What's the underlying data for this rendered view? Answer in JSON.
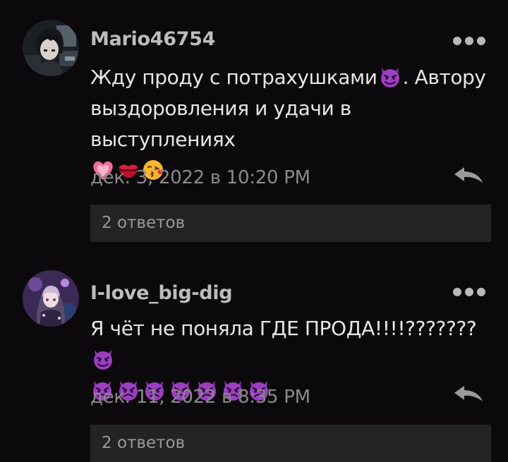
{
  "comments": [
    {
      "username": "Mario46754",
      "text_line1": "Жду проду с потрахушками",
      "text_line1_tail": ". Автору",
      "text_line2": "выздоровления и удачи в выступлениях",
      "timestamp": "дек. 3, 2022 в 10:20 PM",
      "replies_label": "2 ответов",
      "avatar_icon": "avatar-anime-boy",
      "emojis_line1": [
        "smiling-imp-emoji"
      ],
      "emojis_line3": [
        "growing-heart-emoji",
        "kiss-mark-emoji",
        "kissing-face-emoji"
      ]
    },
    {
      "username": "I-love_big-dig",
      "text_line1": "Я чёт не поняла ГДЕ ПРОДА!!!!???????",
      "timestamp": "дек. 11, 2022 в 8:35 PM",
      "replies_label": "2 ответов",
      "avatar_icon": "avatar-anime-girl",
      "emojis_line1": [
        "smiling-imp-emoji"
      ],
      "emojis_line2_count": 7
    }
  ],
  "colors": {
    "background": "#0b090c",
    "username": "#bdbdbd",
    "body_text": "#e6e6e6",
    "timestamp": "#8a8a8a",
    "replies_bar": "#242325",
    "imp_purple": "#9b3fbf"
  },
  "icons": {
    "more": "more-dots-icon",
    "reply": "reply-arrow-icon"
  }
}
